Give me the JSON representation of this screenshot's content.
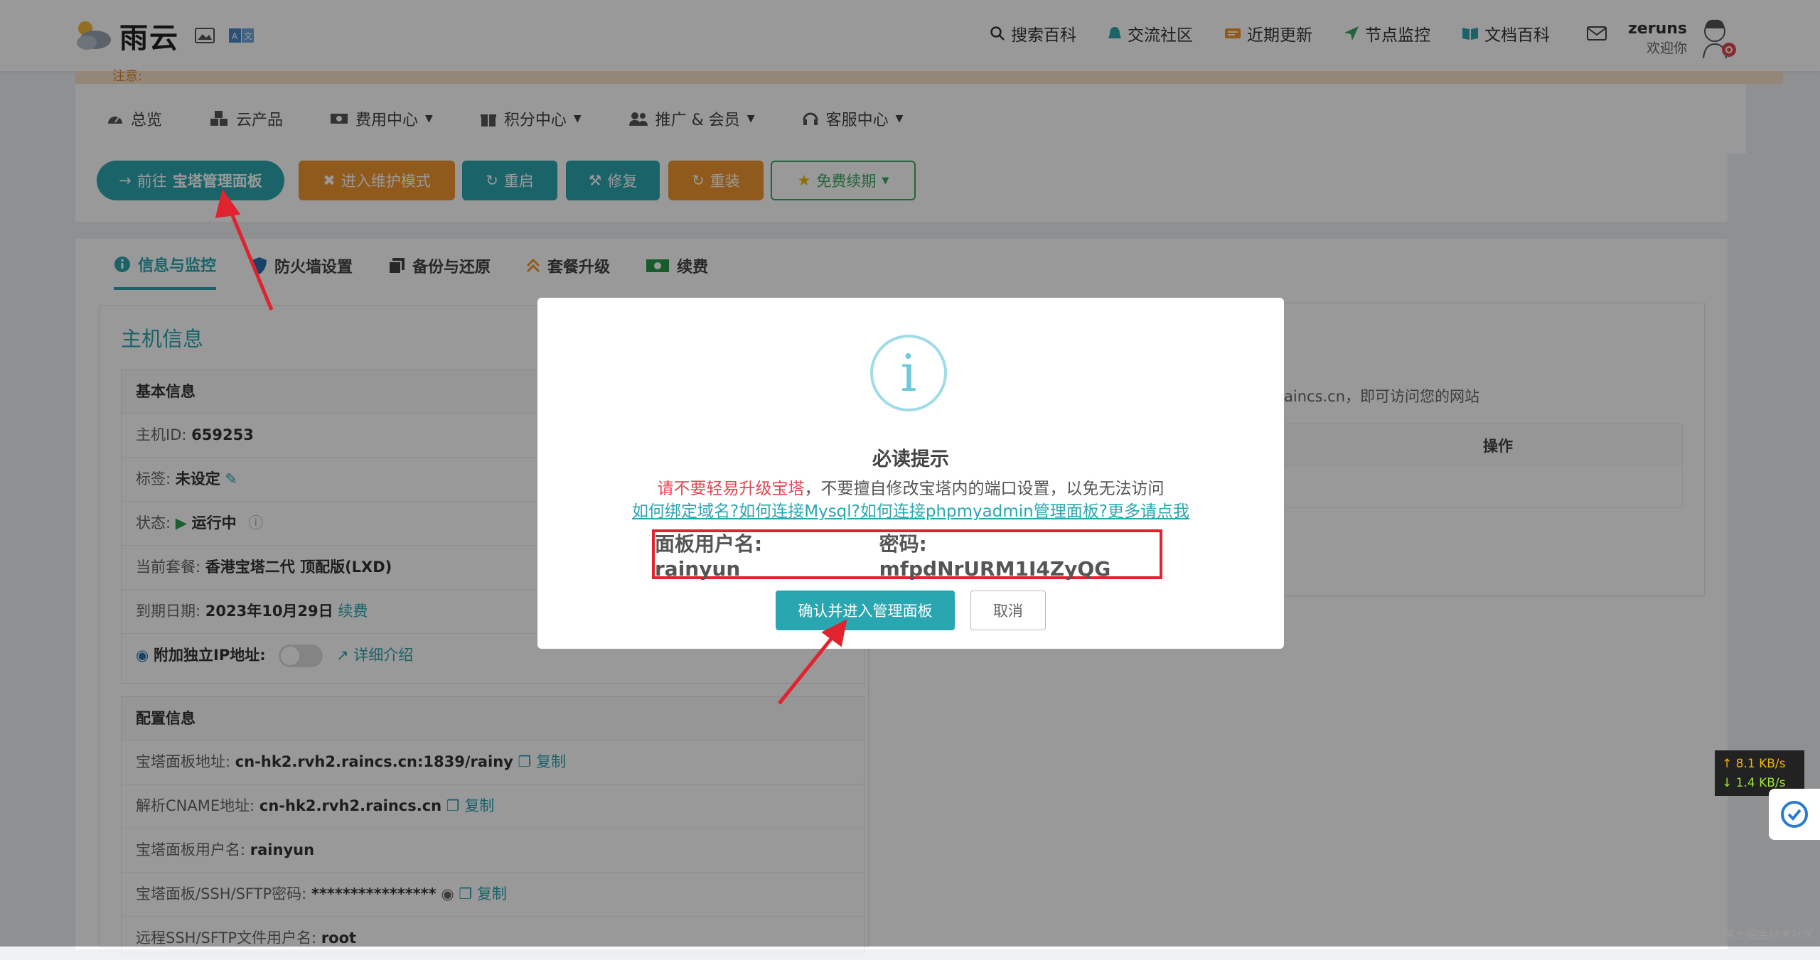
{
  "brand": {
    "name": "雨云"
  },
  "topnav": [
    {
      "label": "搜索百科",
      "icon": "search-icon"
    },
    {
      "label": "交流社区",
      "icon": "community-icon"
    },
    {
      "label": "近期更新",
      "icon": "updates-icon"
    },
    {
      "label": "节点监控",
      "icon": "monitor-icon"
    },
    {
      "label": "文档百科",
      "icon": "book-icon"
    }
  ],
  "user": {
    "name": "zeruns",
    "greeting": "欢迎你"
  },
  "notice": "注意:",
  "menu": [
    {
      "label": "总览",
      "icon": "dashboard-icon"
    },
    {
      "label": "云产品",
      "icon": "cubes-icon"
    },
    {
      "label": "费用中心",
      "icon": "money-icon",
      "dropdown": true
    },
    {
      "label": "积分中心",
      "icon": "gift-icon",
      "dropdown": true
    },
    {
      "label": "推广 & 会员",
      "icon": "users-icon",
      "dropdown": true
    },
    {
      "label": "客服中心",
      "icon": "headset-icon",
      "dropdown": true
    }
  ],
  "actions": {
    "goto_panel_prefix": "前往",
    "goto_panel": "宝塔管理面板",
    "maintenance": "进入维护模式",
    "restart": "重启",
    "repair": "修复",
    "reinstall": "重装",
    "renew_free": "免费续期"
  },
  "tabs": [
    {
      "label": "信息与监控",
      "icon": "info-icon",
      "active": true
    },
    {
      "label": "防火墙设置",
      "icon": "shield-icon"
    },
    {
      "label": "备份与还原",
      "icon": "copy-icon"
    },
    {
      "label": "套餐升级",
      "icon": "upgrade-icon"
    },
    {
      "label": "续费",
      "icon": "cash-icon"
    }
  ],
  "host": {
    "title": "主机信息",
    "basic_title": "基本信息",
    "id_label": "主机ID:",
    "id": "659253",
    "tag_label": "标签:",
    "tag": "未设定",
    "status_label": "状态:",
    "status": "运行中",
    "plan_label": "当前套餐:",
    "plan": "香港宝塔二代 顶配版(LXD)",
    "expire_label": "到期日期:",
    "expire": "2023年10月29日",
    "renew_link": "续费",
    "ip_label": "附加独立IP地址:",
    "ip_detail": "详细介绍",
    "config_title": "配置信息",
    "panel_addr_label": "宝塔面板地址:",
    "panel_addr": "cn-hk2.rvh2.raincs.cn:1839/rainy",
    "cname_label": "解析CNAME地址:",
    "cname": "cn-hk2.rvh2.raincs.cn",
    "panel_user_label": "宝塔面板用户名:",
    "panel_user": "rainyun",
    "pwd_label": "宝塔面板/SSH/SFTP密码:",
    "pwd": "****************",
    "ssh_user_label": "远程SSH/SFTP文件用户名:",
    "ssh_user": "root",
    "copy": "复制"
  },
  "right_panel": {
    "domain_text": "aincs.cn，即可访问您的网站",
    "col_action": "操作"
  },
  "modal": {
    "icon_char": "i",
    "title": "必读提示",
    "warn_red": "请不要轻易升级宝塔",
    "warn_rest": "，不要擅自修改宝塔内的端口设置，以免无法访问",
    "help_link": "如何绑定域名?如何连接Mysql?如何连接phpmyadmin管理面板?更多请点我",
    "user_label": "面板用户名: rainyun",
    "pwd_label": "密码: mfpdNrURM1I4ZyQG",
    "confirm": "确认并进入管理面板",
    "cancel": "取消"
  },
  "netspeed": {
    "up": "↑ 8.1 KB/s",
    "down": "↓ 1.4 KB/s"
  },
  "watermark": "@稀土掘金技术社区",
  "colors": {
    "accent": "#2aa6b0",
    "orange": "#f0962f",
    "danger": "#e0232e"
  }
}
